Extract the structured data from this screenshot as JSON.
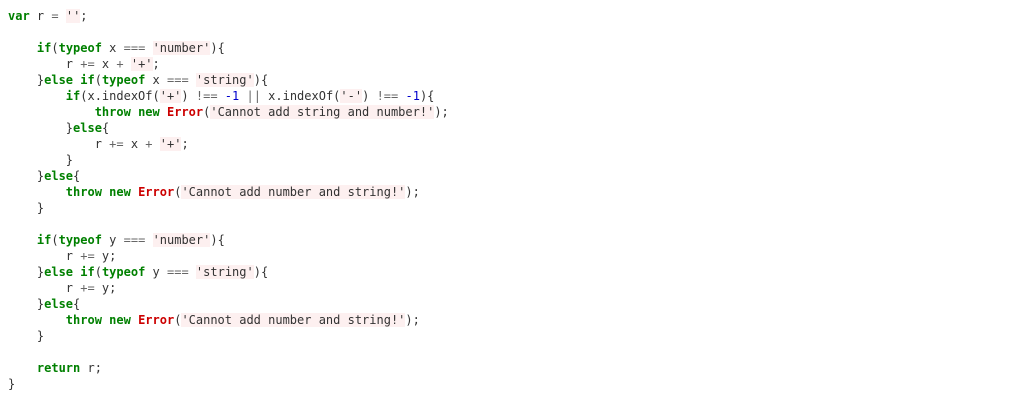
{
  "code": {
    "language": "JavaScript",
    "lines": [
      [
        {
          "t": "var",
          "c": "kw"
        },
        {
          "t": " r ",
          "c": ""
        },
        {
          "t": "=",
          "c": "op"
        },
        {
          "t": " ",
          "c": ""
        },
        {
          "t": "''",
          "c": "str"
        },
        {
          "t": ";",
          "c": ""
        }
      ],
      [],
      [
        {
          "t": "    ",
          "c": ""
        },
        {
          "t": "if",
          "c": "kw"
        },
        {
          "t": "(",
          "c": ""
        },
        {
          "t": "typeof",
          "c": "kw"
        },
        {
          "t": " x ",
          "c": ""
        },
        {
          "t": "===",
          "c": "op"
        },
        {
          "t": " ",
          "c": ""
        },
        {
          "t": "'number'",
          "c": "str"
        },
        {
          "t": "){",
          "c": ""
        }
      ],
      [
        {
          "t": "        r ",
          "c": ""
        },
        {
          "t": "+=",
          "c": "op"
        },
        {
          "t": " x ",
          "c": ""
        },
        {
          "t": "+",
          "c": "op"
        },
        {
          "t": " ",
          "c": ""
        },
        {
          "t": "'+'",
          "c": "str"
        },
        {
          "t": ";",
          "c": ""
        }
      ],
      [
        {
          "t": "    }",
          "c": ""
        },
        {
          "t": "else",
          "c": "kw"
        },
        {
          "t": " ",
          "c": ""
        },
        {
          "t": "if",
          "c": "kw"
        },
        {
          "t": "(",
          "c": ""
        },
        {
          "t": "typeof",
          "c": "kw"
        },
        {
          "t": " x ",
          "c": ""
        },
        {
          "t": "===",
          "c": "op"
        },
        {
          "t": " ",
          "c": ""
        },
        {
          "t": "'string'",
          "c": "str"
        },
        {
          "t": "){",
          "c": ""
        }
      ],
      [
        {
          "t": "        ",
          "c": ""
        },
        {
          "t": "if",
          "c": "kw"
        },
        {
          "t": "(x.indexOf(",
          "c": ""
        },
        {
          "t": "'+'",
          "c": "str"
        },
        {
          "t": ") ",
          "c": ""
        },
        {
          "t": "!==",
          "c": "op"
        },
        {
          "t": " ",
          "c": ""
        },
        {
          "t": "-1",
          "c": "num"
        },
        {
          "t": " ",
          "c": ""
        },
        {
          "t": "||",
          "c": "op"
        },
        {
          "t": " x.indexOf(",
          "c": ""
        },
        {
          "t": "'-'",
          "c": "str"
        },
        {
          "t": ") ",
          "c": ""
        },
        {
          "t": "!==",
          "c": "op"
        },
        {
          "t": " ",
          "c": ""
        },
        {
          "t": "-1",
          "c": "num"
        },
        {
          "t": "){",
          "c": ""
        }
      ],
      [
        {
          "t": "            ",
          "c": ""
        },
        {
          "t": "throw",
          "c": "kw"
        },
        {
          "t": " ",
          "c": ""
        },
        {
          "t": "new",
          "c": "kw"
        },
        {
          "t": " ",
          "c": ""
        },
        {
          "t": "Error",
          "c": "err"
        },
        {
          "t": "(",
          "c": ""
        },
        {
          "t": "'Cannot add string and number!'",
          "c": "str"
        },
        {
          "t": ");",
          "c": ""
        }
      ],
      [
        {
          "t": "        }",
          "c": ""
        },
        {
          "t": "else",
          "c": "kw"
        },
        {
          "t": "{",
          "c": ""
        }
      ],
      [
        {
          "t": "            r ",
          "c": ""
        },
        {
          "t": "+=",
          "c": "op"
        },
        {
          "t": " x ",
          "c": ""
        },
        {
          "t": "+",
          "c": "op"
        },
        {
          "t": " ",
          "c": ""
        },
        {
          "t": "'+'",
          "c": "str"
        },
        {
          "t": ";",
          "c": ""
        }
      ],
      [
        {
          "t": "        }",
          "c": ""
        }
      ],
      [
        {
          "t": "    }",
          "c": ""
        },
        {
          "t": "else",
          "c": "kw"
        },
        {
          "t": "{",
          "c": ""
        }
      ],
      [
        {
          "t": "        ",
          "c": ""
        },
        {
          "t": "throw",
          "c": "kw"
        },
        {
          "t": " ",
          "c": ""
        },
        {
          "t": "new",
          "c": "kw"
        },
        {
          "t": " ",
          "c": ""
        },
        {
          "t": "Error",
          "c": "err"
        },
        {
          "t": "(",
          "c": ""
        },
        {
          "t": "'Cannot add number and string!'",
          "c": "str"
        },
        {
          "t": ");",
          "c": ""
        }
      ],
      [
        {
          "t": "    }",
          "c": ""
        }
      ],
      [],
      [
        {
          "t": "    ",
          "c": ""
        },
        {
          "t": "if",
          "c": "kw"
        },
        {
          "t": "(",
          "c": ""
        },
        {
          "t": "typeof",
          "c": "kw"
        },
        {
          "t": " y ",
          "c": ""
        },
        {
          "t": "===",
          "c": "op"
        },
        {
          "t": " ",
          "c": ""
        },
        {
          "t": "'number'",
          "c": "str"
        },
        {
          "t": "){",
          "c": ""
        }
      ],
      [
        {
          "t": "        r ",
          "c": ""
        },
        {
          "t": "+=",
          "c": "op"
        },
        {
          "t": " y;",
          "c": ""
        }
      ],
      [
        {
          "t": "    }",
          "c": ""
        },
        {
          "t": "else",
          "c": "kw"
        },
        {
          "t": " ",
          "c": ""
        },
        {
          "t": "if",
          "c": "kw"
        },
        {
          "t": "(",
          "c": ""
        },
        {
          "t": "typeof",
          "c": "kw"
        },
        {
          "t": " y ",
          "c": ""
        },
        {
          "t": "===",
          "c": "op"
        },
        {
          "t": " ",
          "c": ""
        },
        {
          "t": "'string'",
          "c": "str"
        },
        {
          "t": "){",
          "c": ""
        }
      ],
      [
        {
          "t": "        r ",
          "c": ""
        },
        {
          "t": "+=",
          "c": "op"
        },
        {
          "t": " y;",
          "c": ""
        }
      ],
      [
        {
          "t": "    }",
          "c": ""
        },
        {
          "t": "else",
          "c": "kw"
        },
        {
          "t": "{",
          "c": ""
        }
      ],
      [
        {
          "t": "        ",
          "c": ""
        },
        {
          "t": "throw",
          "c": "kw"
        },
        {
          "t": " ",
          "c": ""
        },
        {
          "t": "new",
          "c": "kw"
        },
        {
          "t": " ",
          "c": ""
        },
        {
          "t": "Error",
          "c": "err"
        },
        {
          "t": "(",
          "c": ""
        },
        {
          "t": "'Cannot add number and string!'",
          "c": "str"
        },
        {
          "t": ");",
          "c": ""
        }
      ],
      [
        {
          "t": "    }",
          "c": ""
        }
      ],
      [],
      [
        {
          "t": "    ",
          "c": ""
        },
        {
          "t": "return",
          "c": "kw"
        },
        {
          "t": " r;",
          "c": ""
        }
      ],
      [
        {
          "t": "}",
          "c": ""
        }
      ]
    ]
  }
}
